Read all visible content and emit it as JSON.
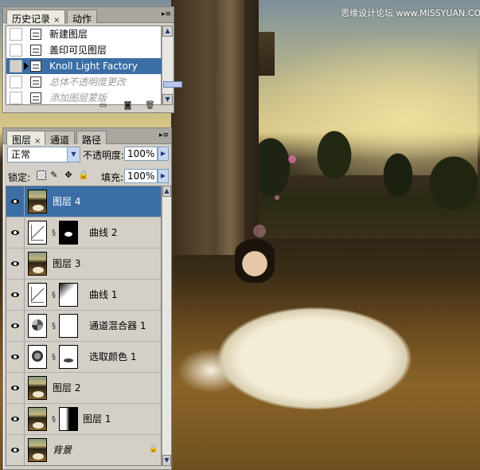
{
  "watermark": "思缘设计论坛  www.MISSYUAN.COM",
  "history_palette": {
    "tabs": [
      {
        "label": "历史记录",
        "close": "×",
        "active": true
      },
      {
        "label": "动作",
        "close": "",
        "active": false
      }
    ],
    "menu_icon": "palette-menu-icon",
    "items": [
      {
        "label": "新建图层",
        "state": "normal"
      },
      {
        "label": "盖印可见图层",
        "state": "normal"
      },
      {
        "label": "Knoll Light Factory",
        "state": "selected"
      },
      {
        "label": "总体不透明度更改",
        "state": "dim"
      },
      {
        "label": "添加图层蒙版",
        "state": "dim"
      }
    ],
    "footer_icons": [
      "new-document-icon",
      "snapshot-icon",
      "trash-icon"
    ]
  },
  "layers_palette": {
    "tabs": [
      {
        "label": "图层",
        "close": "×",
        "active": true
      },
      {
        "label": "通道",
        "close": "",
        "active": false
      },
      {
        "label": "路径",
        "close": "",
        "active": false
      }
    ],
    "blend_mode": "正常",
    "opacity_label": "不透明度:",
    "opacity_value": "100%",
    "lock_label": "锁定:",
    "fill_label": "填充:",
    "fill_value": "100%",
    "layers": [
      {
        "name": "图层 4",
        "thumb": "photo",
        "mask": null,
        "selected": true
      },
      {
        "name": "曲线 2",
        "thumb": "curve",
        "mask": "black-with-white-shape",
        "selected": false
      },
      {
        "name": "图层 3",
        "thumb": "photo",
        "mask": null,
        "selected": false
      },
      {
        "name": "曲线 1",
        "thumb": "curve",
        "mask": "white-gradient",
        "selected": false
      },
      {
        "name": "通道混合器 1",
        "thumb": "mixer",
        "mask": "white",
        "selected": false
      },
      {
        "name": "选取颜色 1",
        "thumb": "selcolor",
        "mask": "white-shape",
        "selected": false
      },
      {
        "name": "图层 2",
        "thumb": "photo",
        "mask": null,
        "selected": false
      },
      {
        "name": "图层 1",
        "thumb": "photo",
        "mask": "white-black-gradient",
        "selected": false
      },
      {
        "name": "背景",
        "thumb": "photo",
        "mask": null,
        "selected": false,
        "locked": true
      }
    ]
  }
}
